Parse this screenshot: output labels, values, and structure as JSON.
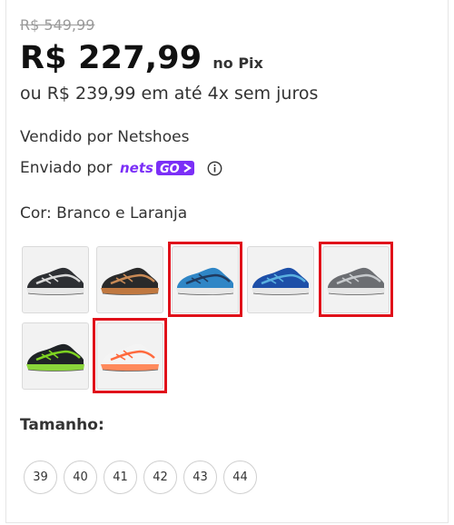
{
  "price": {
    "old": "R$ 549,99",
    "current": "R$ 227,99",
    "pix_label": "no Pix",
    "installments": "ou R$ 239,99 em até 4x sem juros"
  },
  "seller": {
    "sold_by": "Vendido por Netshoes"
  },
  "shipping": {
    "label": "Enviado por",
    "logo_text": "netsGO>",
    "logo_color": "#7b2ff7",
    "info_icon": "info-icon"
  },
  "color": {
    "label": "Cor: Branco e Laranja",
    "options": [
      {
        "name": "shoe-black-white",
        "upper": "#2d2f33",
        "accent": "#d8d8d8",
        "sole": "#e6e6e6",
        "highlighted": false
      },
      {
        "name": "shoe-black-orange",
        "upper": "#2a2a2a",
        "accent": "#c98a55",
        "sole": "#c07840",
        "highlighted": false
      },
      {
        "name": "shoe-blue-navy",
        "upper": "#2f86c6",
        "accent": "#1f3a5f",
        "sole": "#e6e6e6",
        "highlighted": true
      },
      {
        "name": "shoe-royal-blue",
        "upper": "#1d4fa8",
        "accent": "#5ab0e0",
        "sole": "#e6e6e6",
        "highlighted": false
      },
      {
        "name": "shoe-grey-silver",
        "upper": "#6c6e72",
        "accent": "#c6c9cc",
        "sole": "#e6e6e6",
        "highlighted": true
      },
      {
        "name": "shoe-black-green",
        "upper": "#1f2326",
        "accent": "#7ed321",
        "sole": "#8ad53a",
        "highlighted": false
      },
      {
        "name": "shoe-white-orange",
        "upper": "#f4f4f4",
        "accent": "#ff6a3d",
        "sole": "#ff8a5c",
        "highlighted": true
      }
    ],
    "highlight_color": "#e0101a"
  },
  "size": {
    "label": "Tamanho:",
    "options": [
      "39",
      "40",
      "41",
      "42",
      "43",
      "44"
    ]
  }
}
